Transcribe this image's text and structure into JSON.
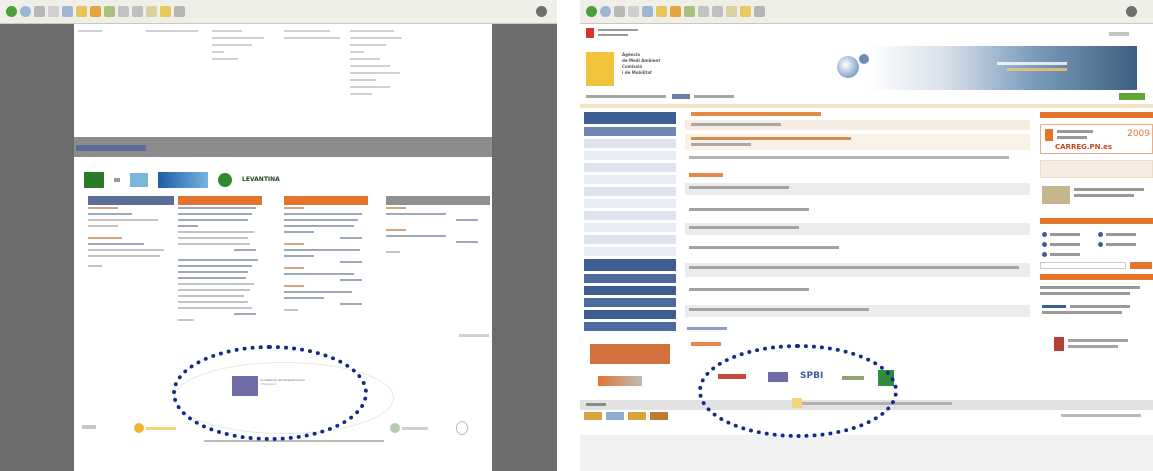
{
  "left_screen": {
    "logos_row": [
      "LEVANTINA"
    ],
    "footer_center_text": [
      "Conselleria de Infraestructura",
      "i Transport"
    ]
  },
  "right_screen": {
    "banner_texts": [
      "Agència",
      "de Medi Ambient",
      "Comissió",
      "i de Mobilitat"
    ],
    "side_logo": "CARREG.PN.es",
    "side_year": "2009",
    "footer_logos": [
      "SPBI"
    ]
  },
  "colors": {
    "left_bg": "#6c6c6c",
    "orange": "#e2742c",
    "navy": "#596f97",
    "green": "#5ea632",
    "yellow": "#f1c33a",
    "ellipse_dots": "#142a8c"
  }
}
